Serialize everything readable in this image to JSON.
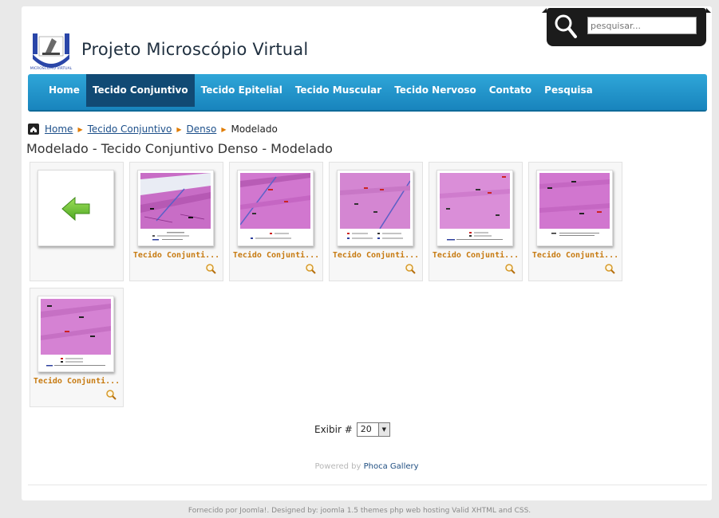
{
  "header": {
    "site_title": "Projeto Microscópio Virtual",
    "logo_text": "MICROSCÓPIO VIRTUAL",
    "search_placeholder": "pesquisar..."
  },
  "nav": {
    "items": [
      {
        "label": "Home"
      },
      {
        "label": "Tecido Conjuntivo"
      },
      {
        "label": "Tecido Epitelial"
      },
      {
        "label": "Tecido Muscular"
      },
      {
        "label": "Tecido Nervoso"
      },
      {
        "label": "Contato"
      },
      {
        "label": "Pesquisa"
      }
    ],
    "active": "Tecido Conjuntivo"
  },
  "breadcrumb": {
    "home": "Home",
    "level1": "Tecido Conjuntivo",
    "level2": "Denso",
    "current": "Modelado"
  },
  "gallery": {
    "title": "Modelado - Tecido Conjuntivo Denso - Modelado",
    "back_icon": "green-back-arrow-icon",
    "items": [
      {
        "caption": "Tecido Conjunti..."
      },
      {
        "caption": "Tecido Conjunti..."
      },
      {
        "caption": "Tecido Conjunti..."
      },
      {
        "caption": "Tecido Conjunti..."
      },
      {
        "caption": "Tecido Conjunti..."
      },
      {
        "caption": "Tecido Conjunti..."
      }
    ]
  },
  "pagination": {
    "label": "Exibir #",
    "value": "20"
  },
  "powered": {
    "prefix": "Powered by",
    "brand": "Phoca Gallery"
  },
  "footer": {
    "text": "Fornecido por Joomla!. Designed by: joomla 1.5 themes php web hosting Valid XHTML and CSS."
  },
  "colors": {
    "nav_blue": "#1f93cb",
    "nav_active": "#114a74",
    "caption_orange": "#c77a10",
    "tissue_pink": "#d98ad8"
  }
}
